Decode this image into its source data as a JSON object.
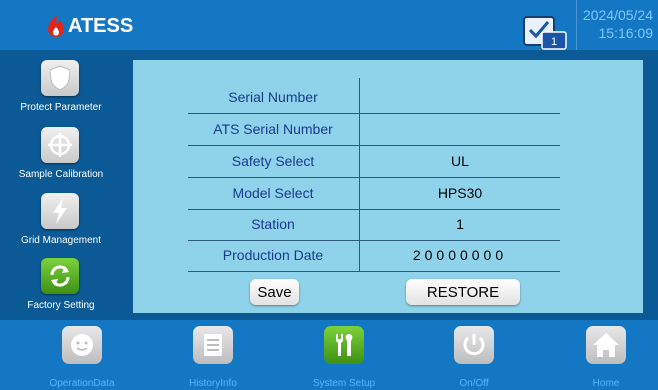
{
  "header": {
    "brand": "ATESS",
    "message_count": "1",
    "date": "2024/05/24",
    "time": "15:16:09"
  },
  "sidebar": {
    "items": [
      {
        "label": "Protect Parameter",
        "icon": "shield-icon"
      },
      {
        "label": "Sample Calibration",
        "icon": "crosshair-icon"
      },
      {
        "label": "Grid Management",
        "icon": "lightning-icon"
      },
      {
        "label": "Factory Setting",
        "icon": "refresh-icon",
        "active": true
      }
    ]
  },
  "main": {
    "rows": [
      {
        "label": "Serial Number",
        "value": ""
      },
      {
        "label": "ATS Serial Number",
        "value": ""
      },
      {
        "label": "Safety Select",
        "value": "UL"
      },
      {
        "label": "Model Select",
        "value": "HPS30"
      },
      {
        "label": "Station",
        "value": "1"
      },
      {
        "label": "Production Date",
        "value": "20000000"
      }
    ],
    "save_label": "Save",
    "restore_label": "RESTORE"
  },
  "bottom_nav": {
    "items": [
      {
        "label": "OperationData",
        "icon": "face-icon"
      },
      {
        "label": "HistoryInfo",
        "icon": "document-icon"
      },
      {
        "label": "System Setup",
        "icon": "tools-icon",
        "active": true
      },
      {
        "label": "On/Off",
        "icon": "power-icon"
      },
      {
        "label": "Home",
        "icon": "home-icon"
      }
    ]
  },
  "colors": {
    "topbar": "#1477c4",
    "background": "#0b5a96",
    "panel": "#8fd3ea",
    "label_text": "#1a3a90",
    "active_green": "#5fb82a"
  }
}
